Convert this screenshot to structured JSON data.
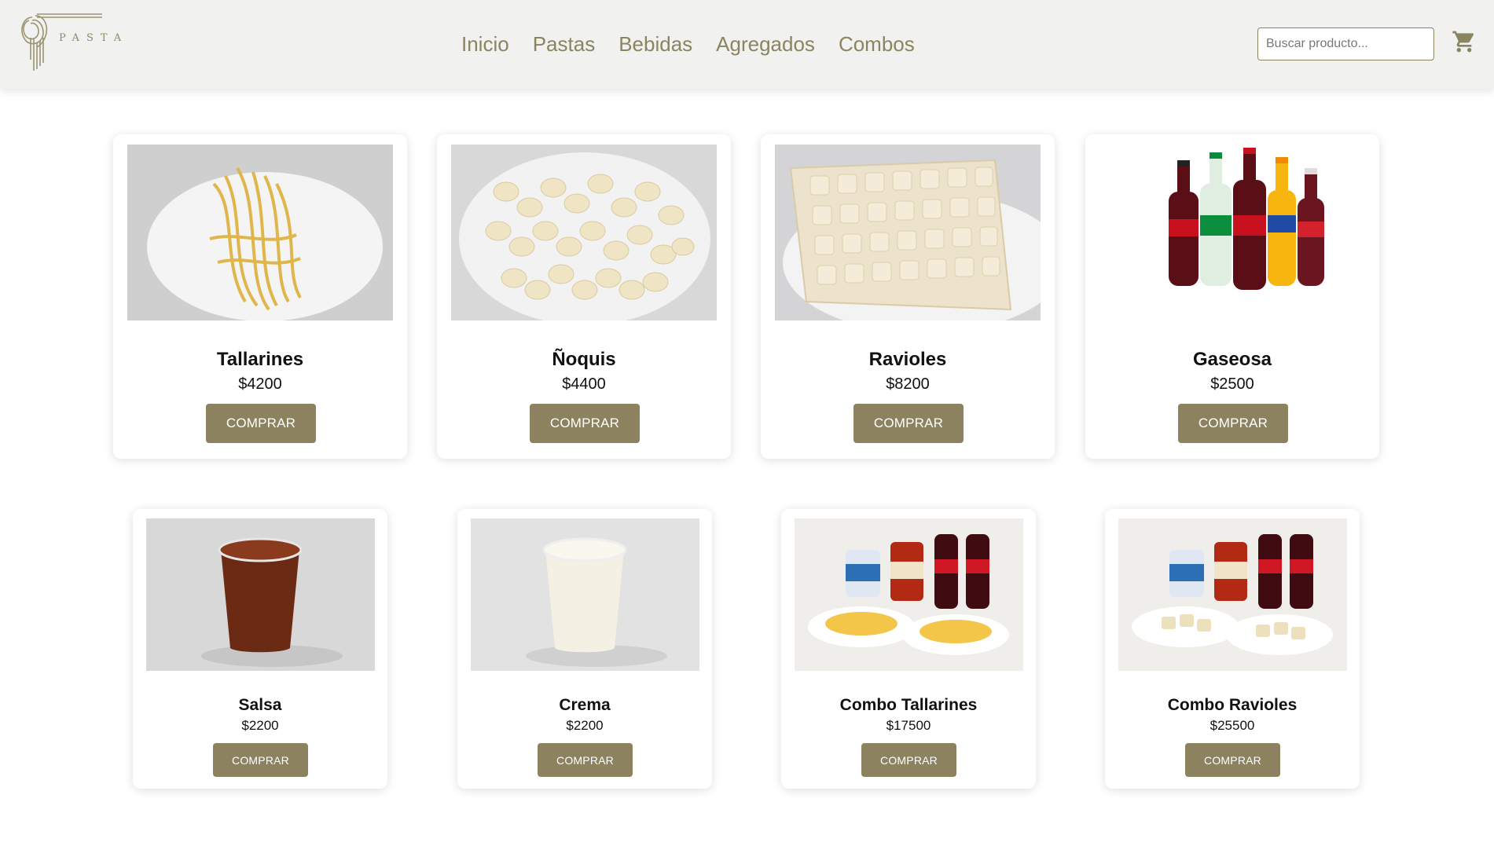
{
  "brand": {
    "logo_text": "PASTA"
  },
  "nav": {
    "items": [
      "Inicio",
      "Pastas",
      "Bebidas",
      "Agregados",
      "Combos"
    ]
  },
  "search": {
    "placeholder": "Buscar producto...",
    "value": ""
  },
  "cart": {
    "icon": "shopping-cart-icon"
  },
  "colors": {
    "accent": "#8c8260",
    "header_bg": "#f1f1ef",
    "nav_text": "#8b8460"
  },
  "products": [
    {
      "name": "Tallarines",
      "price": "$4200",
      "button": "COMPRAR",
      "image": "tallarines-image"
    },
    {
      "name": "Ñoquis",
      "price": "$4400",
      "button": "COMPRAR",
      "image": "noquis-image"
    },
    {
      "name": "Ravioles",
      "price": "$8200",
      "button": "COMPRAR",
      "image": "ravioles-image"
    },
    {
      "name": "Gaseosa",
      "price": "$2500",
      "button": "COMPRAR",
      "image": "gaseosa-image"
    },
    {
      "name": "Salsa",
      "price": "$2200",
      "button": "COMPRAR",
      "image": "salsa-image"
    },
    {
      "name": "Crema",
      "price": "$2200",
      "button": "COMPRAR",
      "image": "crema-image"
    },
    {
      "name": "Combo Tallarines",
      "price": "$17500",
      "button": "COMPRAR",
      "image": "combo-tallarines-image"
    },
    {
      "name": "Combo Ravioles",
      "price": "$25500",
      "button": "COMPRAR",
      "image": "combo-ravioles-image"
    }
  ]
}
